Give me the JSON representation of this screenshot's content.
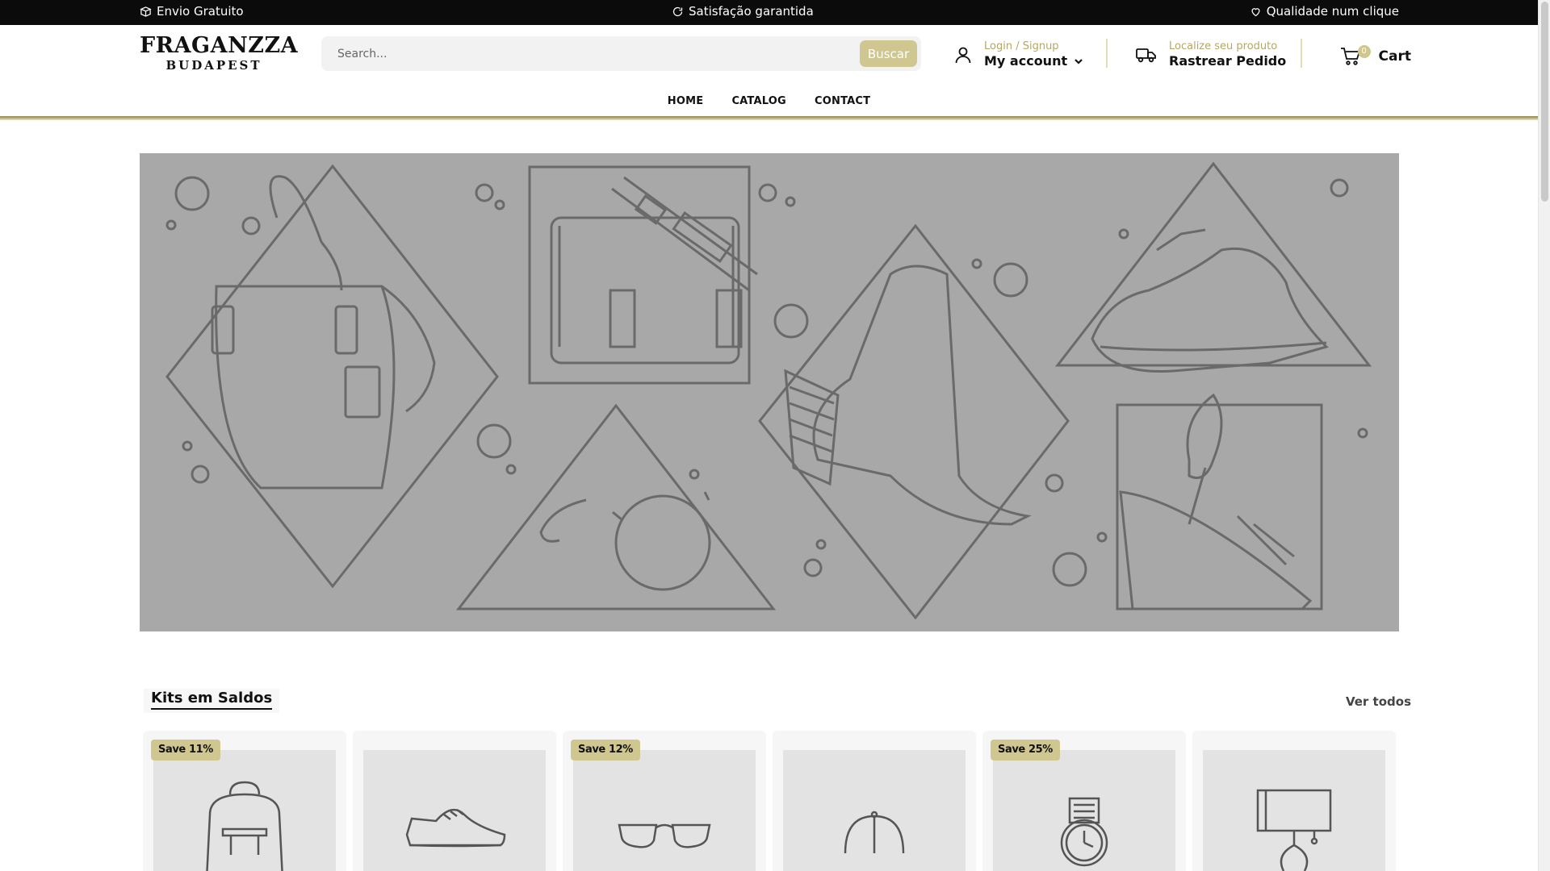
{
  "topbar": {
    "items": [
      "Envio Gratuito",
      "Satisfação garantida",
      "Qualidade num clique"
    ]
  },
  "brand": {
    "line1": "FRAGANZZA",
    "line2": "BUDAPEST"
  },
  "search": {
    "placeholder": "Search...",
    "button": "Buscar",
    "accent": "#cfc78f"
  },
  "account": {
    "small": "Login / Signup",
    "label": "My account"
  },
  "track": {
    "small": "Localize seu produto",
    "label": "Rastrear Pedido"
  },
  "cart": {
    "count": "0",
    "label": "Cart"
  },
  "nav": [
    "HOME",
    "CATALOG",
    "CONTACT"
  ],
  "section": {
    "title": "Kits em Saldos",
    "see_all": "Ver todos"
  },
  "products": [
    {
      "badge": "Save 11%",
      "icon": "backpack-icon"
    },
    {
      "badge": "",
      "icon": "sneaker-icon"
    },
    {
      "badge": "Save 12%",
      "icon": "sunglasses-icon"
    },
    {
      "badge": "",
      "icon": "cap-icon"
    },
    {
      "badge": "Save 25%",
      "icon": "watch-icon"
    },
    {
      "badge": "",
      "icon": "lamp-icon"
    }
  ]
}
